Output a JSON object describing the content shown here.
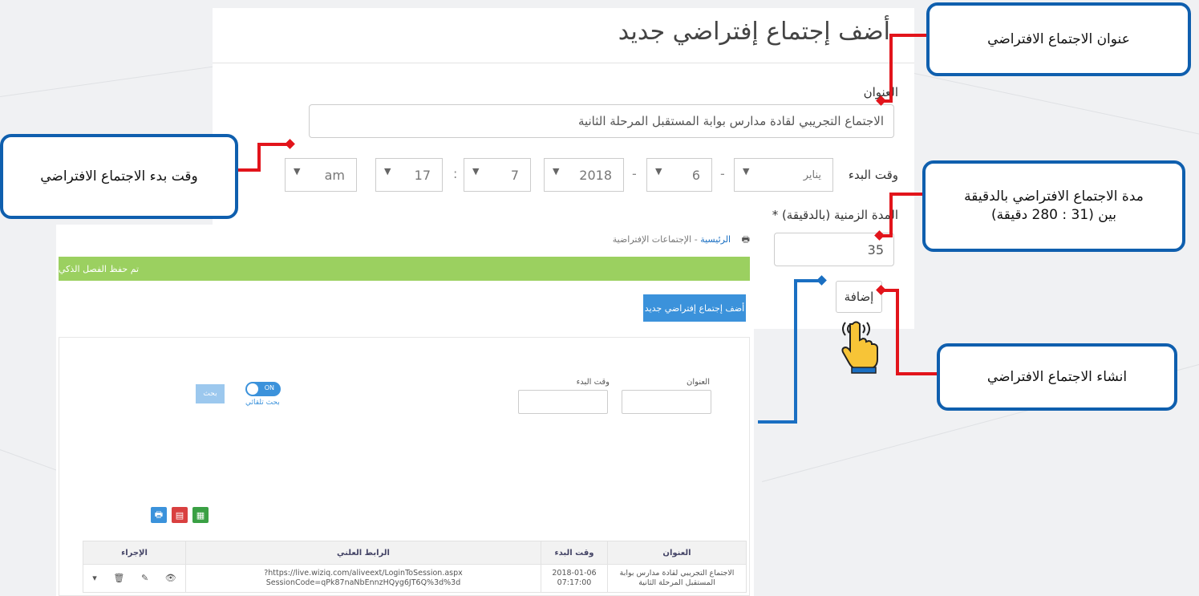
{
  "callouts": {
    "title": "عنوان الاجتماع الافتراضي",
    "start_time": "وقت بدء الاجتماع الافتراضي",
    "duration_line1": "مدة الاجتماع الافتراضي بالدقيقة",
    "duration_line2": "بين (31 : 280 دقيقة)",
    "create": "انشاء الاجتماع الافتراضي"
  },
  "form": {
    "heading": "أضف إجتماع إفتراضي جديد",
    "title_label": "العنوان",
    "title_value": "الاجتماع التجريبي لقادة مدارس بوابة المستقبل المرحلة الثانية",
    "start_label": "وقت البدء",
    "month": "يناير",
    "day": "6",
    "year": "2018",
    "minute": "7",
    "hour": "17",
    "ampm": "am",
    "dash": "-",
    "colon": ":",
    "duration_label": "المدة الزمنية (بالدقيقة) *",
    "duration_value": "35",
    "add_button": "إضافة"
  },
  "app": {
    "breadcrumb_home": "الرئيسية",
    "breadcrumb_sep": " - ",
    "breadcrumb_page": "الإجتماعات الإفتراضية",
    "success_message": "تم حفظ الفصل الذكي",
    "add_new_button": "أضف إجتماع إفتراضي جديد",
    "search": {
      "title_label": "العنوان",
      "start_label": "وقت البدء",
      "toggle_label": "ON",
      "auto_search": "بحث تلقائي",
      "search_button": "بحث"
    },
    "table": {
      "headers": [
        "العنوان",
        "وقت البدء",
        "الرابط العلني",
        "الإجراء"
      ],
      "rows": [
        {
          "title": "الاجتماع التجريبي لقادة مدارس بوابة المستقبل المرحلة الثانية",
          "date": "2018-01-06",
          "time": "07:17:00",
          "link1": "https://live.wiziq.com/aliveext/LoginToSession.aspx?",
          "link2": "SessionCode=qPk87naNbEnnzHQyg6JT6Q%3d%3d"
        }
      ]
    }
  },
  "colors": {
    "accent": "#0f5fae",
    "pointer": "#e2141b",
    "success": "#9bd060",
    "primary": "#3b92db"
  }
}
